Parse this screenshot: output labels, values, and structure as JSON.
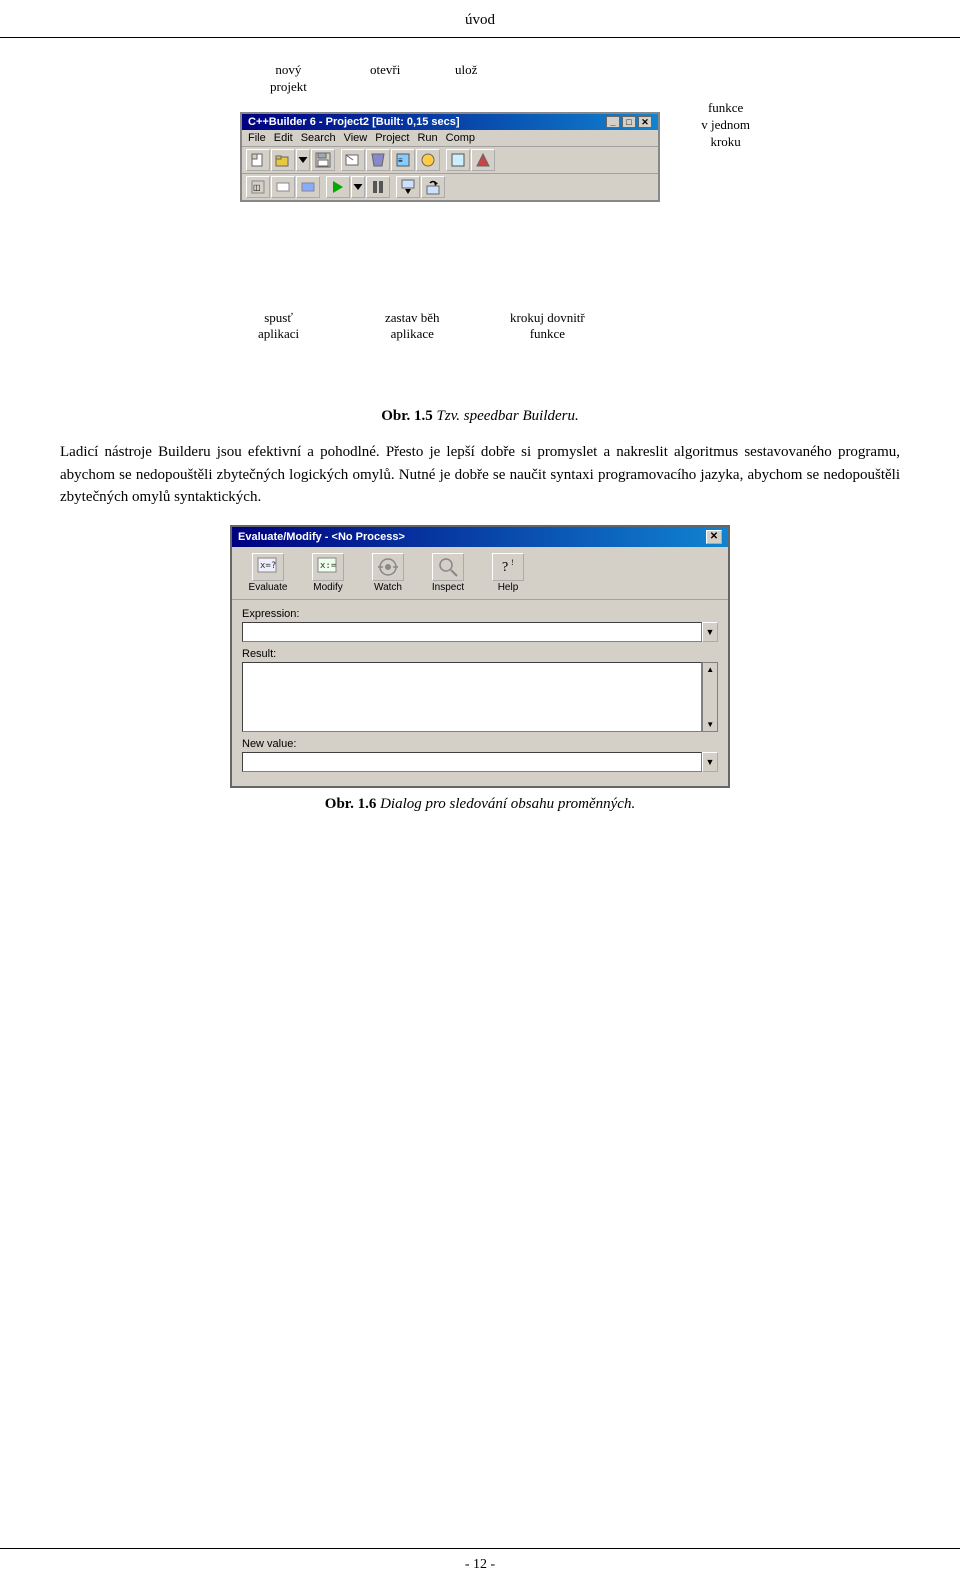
{
  "page": {
    "title": "úvod",
    "footer": "- 12 -"
  },
  "figure1": {
    "caption_prefix": "Obr. 1.5",
    "caption_text": "Tzv. speedbar Builderu.",
    "label_below": "Ladicí nástroje Builderu jsou efektivní a pohodlné.",
    "labels": {
      "novy": "nový\nprojekt",
      "otevri": "otevři",
      "uloz": "ulož",
      "funkce": "funkce\nv jednom\nkroku",
      "spust": "spusť\naplikaci",
      "zastav": "zastav běh\naplikace",
      "krokuj": "krokuj dovnitř\nfunkce"
    },
    "titlebar": "C++Builder 6 - Project2 [Built: 0,15 secs]",
    "menu": [
      "File",
      "Edit",
      "Search",
      "View",
      "Project",
      "Run",
      "Comp"
    ]
  },
  "paragraph1": {
    "text": "Přesto je lepší dobře si promyslet a nakreslit algoritmus sestavovaného programu, abychom se nedopouštěli zbytečných logických omylů. Nutné je dobře se naučit syntaxi programovacího jazyka, abychom se nedopouštěli zbytečných omylů syntaktických."
  },
  "figure2": {
    "titlebar": "Evaluate/Modify - <No Process>",
    "buttons": [
      "Evaluate",
      "Modify",
      "Watch",
      "Inspect",
      "Help"
    ],
    "fields": {
      "expression_label": "Expression:",
      "result_label": "Result:",
      "new_value_label": "New value:"
    },
    "caption_prefix": "Obr. 1.6",
    "caption_text": "Dialog pro sledování obsahu proměnných."
  }
}
